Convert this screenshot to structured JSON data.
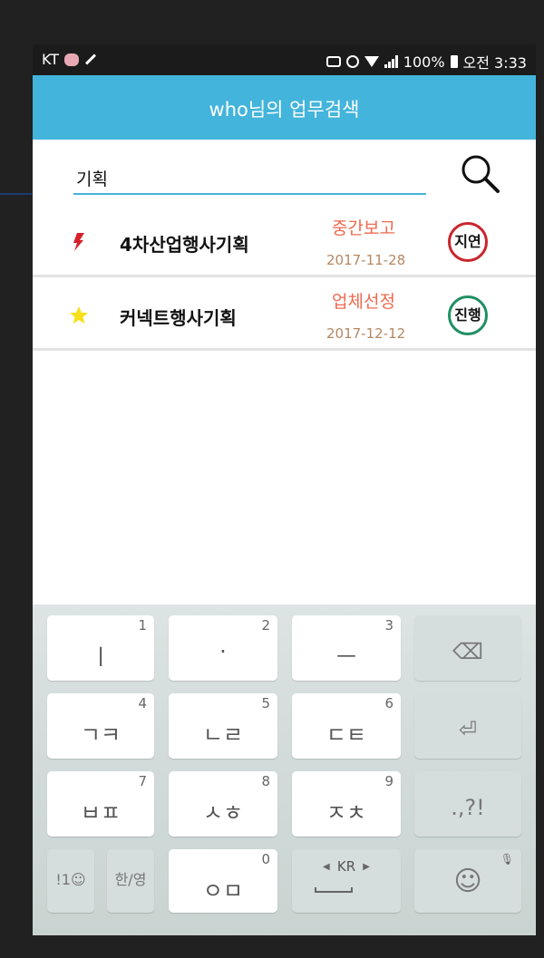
{
  "statusbar": {
    "carrier": "KT",
    "battery": "100%",
    "time": "오전 3:33"
  },
  "appbar": {
    "title": "who님의 업무검색"
  },
  "search": {
    "value": "기획"
  },
  "results": [
    {
      "title": "4차산업행사기획",
      "stage": "중간보고",
      "date": "2017-11-28",
      "status": "지연",
      "icon": "lightning-icon",
      "status_color": "#c8262d"
    },
    {
      "title": "커넥트행사기획",
      "stage": "업체선정",
      "date": "2017-12-12",
      "status": "진행",
      "icon": "star-icon",
      "status_color": "#1f8f63"
    }
  ],
  "colors": {
    "accent": "#43b4db",
    "stage_text": "#ef6a4f",
    "date_text": "#b58763"
  },
  "keyboard": {
    "row1": [
      {
        "label": "ㅣ",
        "num": "1"
      },
      {
        "label": "·",
        "num": "2"
      },
      {
        "label": "ㅡ",
        "num": "3"
      },
      {
        "label": "⌫"
      }
    ],
    "row2": [
      {
        "label": "ㄱㅋ",
        "num": "4"
      },
      {
        "label": "ㄴㄹ",
        "num": "5"
      },
      {
        "label": "ㄷㅌ",
        "num": "6"
      },
      {
        "label": "⏎"
      }
    ],
    "row3": [
      {
        "label": "ㅂㅍ",
        "num": "7"
      },
      {
        "label": "ㅅㅎ",
        "num": "8"
      },
      {
        "label": "ㅈㅊ",
        "num": "9"
      },
      {
        "label": ".,?!"
      }
    ],
    "row4": {
      "symbols": "!1☺",
      "han_yeong": "한/영",
      "oemo": "ㅇㅁ",
      "oemo_num": "0",
      "space_lang": "KR",
      "emoji": "☺"
    }
  }
}
